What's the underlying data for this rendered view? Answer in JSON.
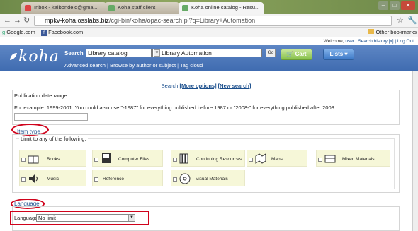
{
  "browser": {
    "tabs": [
      {
        "label": "Inbox - kalbondeld@gmai..."
      },
      {
        "label": "Koha staff client"
      },
      {
        "label": "Koha online catalog - Resu..."
      }
    ],
    "url_host": "mpkv-koha.osslabs.biz",
    "url_path": "/cgi-bin/koha/opac-search.pl?q=Library+Automation",
    "bookmarks": [
      "Google.com",
      "Facebook.com"
    ],
    "other_bookmarks": "Other bookmarks"
  },
  "userbar": {
    "welcome": "Welcome,",
    "user": "user",
    "search_history": "Search history [x]",
    "logout": "Log Out"
  },
  "header": {
    "logo": "koha",
    "search_label": "Search",
    "catalog_select": "Library catalog",
    "query_value": "Library Automation",
    "go_label": "Go",
    "cart_label": "Cart",
    "lists_label": "Lists",
    "advanced_search": "Advanced search",
    "browse": "Browse by author or subject",
    "tag_cloud": "Tag cloud"
  },
  "main": {
    "search_link": "Search",
    "more_options": "[More options]",
    "new_search": "[New search]",
    "pub_date_label": "Publication date range:",
    "pub_date_example": "For example: 1999-2001. You could also use \"-1987\" for everything published before 1987 or \"2008-\" for everything published after 2008.",
    "item_type_title": "Item type",
    "limit_legend": "Limit to any of the following:",
    "item_types": [
      {
        "label": "Books",
        "tag": "BOOK"
      },
      {
        "label": "Computer Files",
        "tag": "COMPUTER FILE"
      },
      {
        "label": "Continuing Resources",
        "tag": "PERIODICAL"
      },
      {
        "label": "Maps",
        "tag": "MAP"
      },
      {
        "label": "Mixed Materials",
        "tag": "KIT"
      },
      {
        "label": "Music",
        "tag": "SOUND"
      },
      {
        "label": "Reference",
        "tag": ""
      },
      {
        "label": "Visual Materials",
        "tag": "DVD"
      }
    ],
    "language_title": "Language",
    "language_label": "Language:",
    "language_value": "No limit"
  },
  "colors": {
    "accent_blue": "#3f6bb0",
    "annotation_red": "#d0021b",
    "cart_green": "#86c04a"
  }
}
